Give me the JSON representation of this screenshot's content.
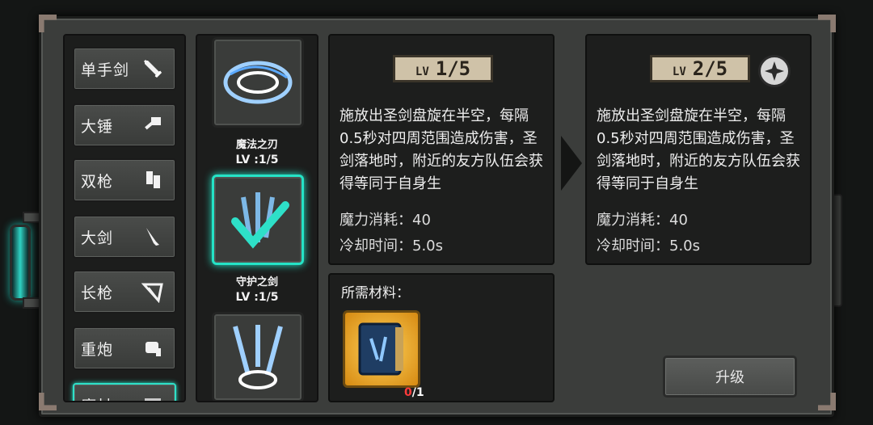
{
  "categories": [
    {
      "label": "单手剑",
      "icon": "sword-icon"
    },
    {
      "label": "大锤",
      "icon": "hammer-icon"
    },
    {
      "label": "双枪",
      "icon": "dual-guns-icon"
    },
    {
      "label": "大剑",
      "icon": "greatsword-icon"
    },
    {
      "label": "长枪",
      "icon": "spear-icon"
    },
    {
      "label": "重炮",
      "icon": "cannon-icon"
    },
    {
      "label": "魔杖",
      "icon": "wand-icon"
    }
  ],
  "skills": [
    {
      "name": "魔法之刃",
      "level": "LV :1/5",
      "icon": "magic-blade-icon"
    },
    {
      "name": "守护之剑",
      "level": "LV :1/5",
      "icon": "guardian-sword-icon",
      "selected": true
    },
    {
      "name": "",
      "level": "",
      "icon": "holy-burst-icon"
    }
  ],
  "current": {
    "lv_label": "LV",
    "lv_value": "1/5",
    "description": "施放出圣剑盘旋在半空，每隔0.5秒对四周范围造成伤害，圣剑落地时，附近的友方队伍会获得等同于自身生",
    "mana": "魔力消耗：40",
    "cooldown": "冷却时间：5.0s"
  },
  "next": {
    "lv_label": "LV",
    "lv_value": "2/5",
    "description": "施放出圣剑盘旋在半空，每隔0.5秒对四周范围造成伤害，圣剑落地时，附近的友方队伍会获得等同于自身生",
    "mana": "魔力消耗：40",
    "cooldown": "冷却时间：5.0s"
  },
  "materials": {
    "title": "所需材料：",
    "item_icon": "spellbook-icon",
    "count_have": "0",
    "count_need": "/1"
  },
  "upgrade_label": "升级",
  "colors": {
    "accent": "#25e3c6",
    "missing": "#ff3b3b",
    "tag": "#cfc2a8"
  }
}
